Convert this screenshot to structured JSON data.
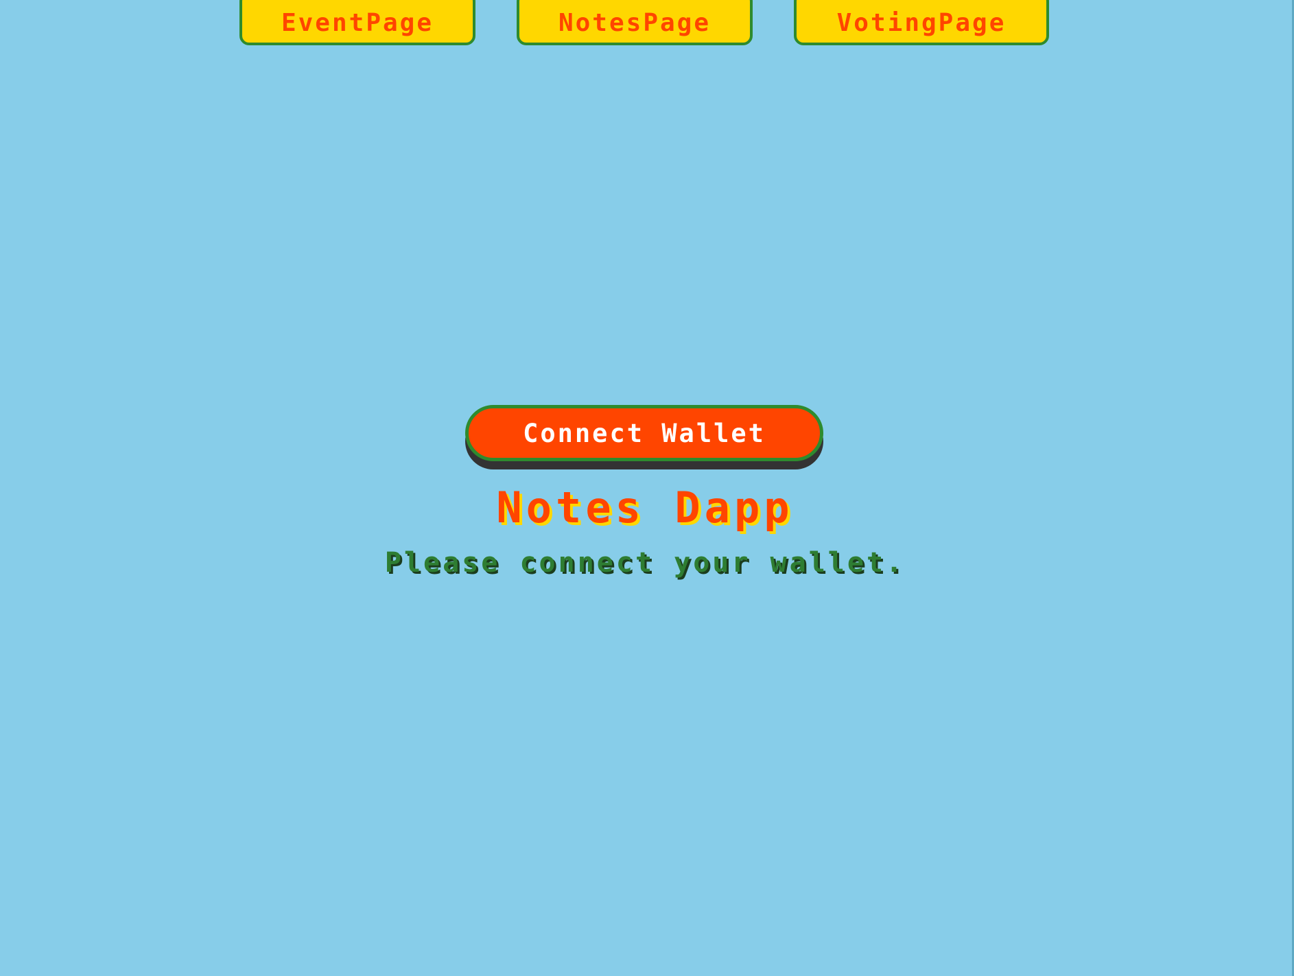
{
  "nav": {
    "items": [
      {
        "label": "EventPage"
      },
      {
        "label": "NotesPage"
      },
      {
        "label": "VotingPage"
      }
    ]
  },
  "wallet": {
    "connect_label": "Connect Wallet"
  },
  "main": {
    "title": "Notes Dapp",
    "message": "Please connect your wallet."
  },
  "colors": {
    "background": "#87CDE9",
    "nav_button_bg": "#FFD700",
    "nav_button_text": "#FF4500",
    "border_green": "#2E8B2E",
    "connect_button_bg": "#FF4500",
    "title_color": "#FF4500",
    "message_color": "#2E7D32"
  }
}
